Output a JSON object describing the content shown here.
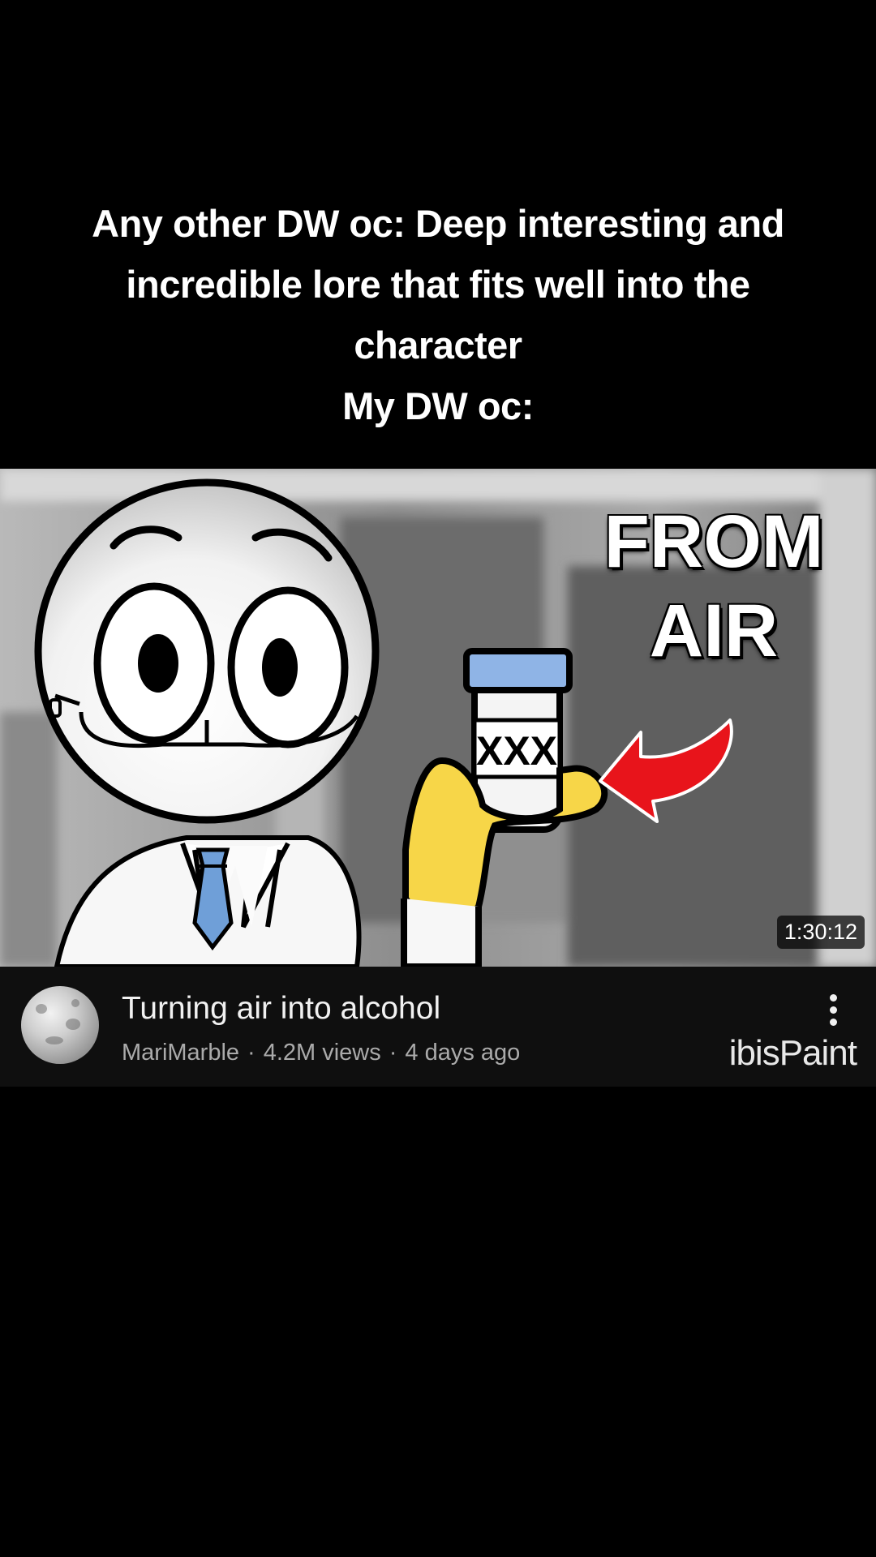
{
  "caption": {
    "lines": [
      "Any other DW oc: Deep interesting and",
      "incredible lore that fits well into the",
      "character",
      "My DW oc:"
    ]
  },
  "thumbnail": {
    "overlay_line1": "FROM",
    "overlay_line2": "AIR",
    "bottle_label": "XXX",
    "duration": "1:30:12"
  },
  "video": {
    "title": "Turning air into alcohol",
    "channel": "MariMarble",
    "views": "4.2M views",
    "age": "4 days ago",
    "separator": "·"
  },
  "watermark": "ibisPaint",
  "icons": {
    "menu": "more-vert-icon",
    "avatar": "channel-avatar"
  },
  "colors": {
    "background": "#000000",
    "info_bar": "#0f0f0f",
    "meta_text": "#aaaaaa",
    "arrow": "#e8141b",
    "glove": "#f7d648",
    "tie": "#6f9fd8",
    "bottle_cap": "#8fb4e6"
  }
}
